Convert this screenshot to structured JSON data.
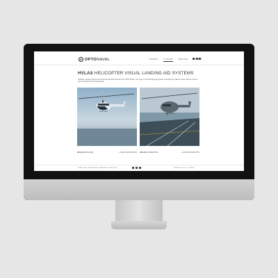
{
  "site": {
    "brand_bold": "OPTO",
    "brand_light": "NAVAL",
    "nav": [
      "COMPANY",
      "SYSTEMS",
      "SERVICES",
      "SEARCH"
    ],
    "active_nav": "SYSTEMS",
    "social_icons": [
      "facebook-icon",
      "twitter-icon",
      "linkedin-icon"
    ]
  },
  "page": {
    "title_bold": "HVLAS",
    "title_rest": "HELICOPTER VISUAL LANDING AID SYSTEMS",
    "intro": "Helicopter Landing Systems for Naval and Merchant Vessels from OPTO NAVAL. Our range of visual landing aid systems is designed for different vessel classes, both for new construction and retrofit projects."
  },
  "cards": [
    {
      "name_bold": "HVLAS",
      "name_rest": "FRIGATE",
      "link": "+ MORE INFORMATION"
    },
    {
      "name_bold": "HVLAS",
      "name_rest": "CORVETTE",
      "link": "+ MORE INFORMATION"
    }
  ],
  "footer": {
    "left": "HOME  |  FAQ  |  IMPRESSUM  |  TERMS AND CONDITIONS",
    "right": "PRIVACY POLICY  |  CONTACT"
  },
  "colors": {
    "background": "#e6e6e6",
    "bezel": "#111111",
    "sky_1": "#b9cfe0",
    "sea": "#2f4a5a"
  }
}
